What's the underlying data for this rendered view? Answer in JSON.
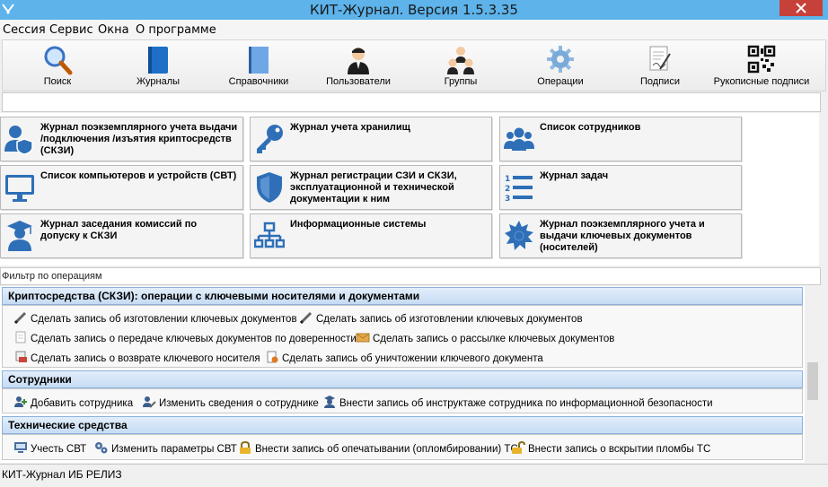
{
  "window": {
    "title": "КИТ-Журнал. Версия 1.5.3.35",
    "accent": "#5db3ea",
    "close_color": "#c7413b"
  },
  "menu": [
    "Сессия",
    "Сервис",
    "Окна",
    "О программе"
  ],
  "toolbar": [
    {
      "label": "Поиск",
      "icon": "magnifier-icon"
    },
    {
      "label": "Журналы",
      "icon": "journal-book-icon"
    },
    {
      "label": "Справочники",
      "icon": "reference-book-icon"
    },
    {
      "label": "Пользователи",
      "icon": "user-icon"
    },
    {
      "label": "Группы",
      "icon": "group-icon"
    },
    {
      "label": "Операции",
      "icon": "gear-icon"
    },
    {
      "label": "Подписи",
      "icon": "signature-icon"
    },
    {
      "label": "Рукописные подписи",
      "icon": "qr-code-icon"
    }
  ],
  "journals": [
    {
      "label": "Журнал поэкземплярного учета выдачи /подключения /изъятия криптосредств (СКЗИ)",
      "icon": "user-shield-icon"
    },
    {
      "label": "Журнал учета хранилищ",
      "icon": "key-icon"
    },
    {
      "label": "Список сотрудников",
      "icon": "users-icon"
    },
    {
      "label": "Список компьютеров и устройств (СВТ)",
      "icon": "monitor-icon"
    },
    {
      "label": "Журнал регистрации СЗИ и СКЗИ, эксплуатационной и технической документации к ним",
      "icon": "shield-icon"
    },
    {
      "label": "Журнал задач",
      "icon": "numbered-list-icon"
    },
    {
      "label": "Журнал заседания комиссий по допуску к СКЗИ",
      "icon": "graduate-icon"
    },
    {
      "label": "Информационные системы",
      "icon": "network-icon"
    },
    {
      "label": "Журнал поэкземплярного учета и выдачи ключевых документов (носителей)",
      "icon": "badge-gear-icon"
    }
  ],
  "filter": {
    "placeholder": "Фильтр по операциям"
  },
  "groups": [
    {
      "title": "Криптосредства (СКЗИ): операции с ключевыми носителями и документами",
      "ops": [
        {
          "label": "Сделать запись об изготовлении ключевых документов",
          "icon": "pen-icon"
        },
        {
          "label": "Сделать запись об изготовлении ключевых документов",
          "icon": "pen-icon"
        },
        {
          "label": "Сделать запись о передаче ключевых документов по доверенности",
          "icon": "document-icon"
        },
        {
          "label": "Сделать запись о рассылке ключевых документов",
          "icon": "envelope-icon"
        },
        {
          "label": "Сделать запись о возврате ключевого носителя",
          "icon": "return-icon"
        },
        {
          "label": "Сделать запись об уничтожении ключевого документа",
          "icon": "destroy-document-icon"
        }
      ]
    },
    {
      "title": "Сотрудники",
      "ops": [
        {
          "label": "Добавить сотрудника",
          "icon": "add-user-icon"
        },
        {
          "label": "Изменить сведения о сотруднике",
          "icon": "edit-user-icon"
        },
        {
          "label": "Внести запись об инструктаже сотрудника по информационной безопасности",
          "icon": "instruct-user-icon"
        }
      ]
    },
    {
      "title": "Технические средства",
      "ops": [
        {
          "label": "Учесть СВТ",
          "icon": "computer-icon"
        },
        {
          "label": "Изменить параметры СВТ",
          "icon": "gears-icon"
        },
        {
          "label": "Внести запись об опечатывании (опломбировании) ТС",
          "icon": "lock-icon"
        },
        {
          "label": "Внести запись о вскрытии пломбы ТС",
          "icon": "unlock-icon"
        }
      ]
    }
  ],
  "status": "КИТ-Журнал ИБ РЕЛИЗ"
}
